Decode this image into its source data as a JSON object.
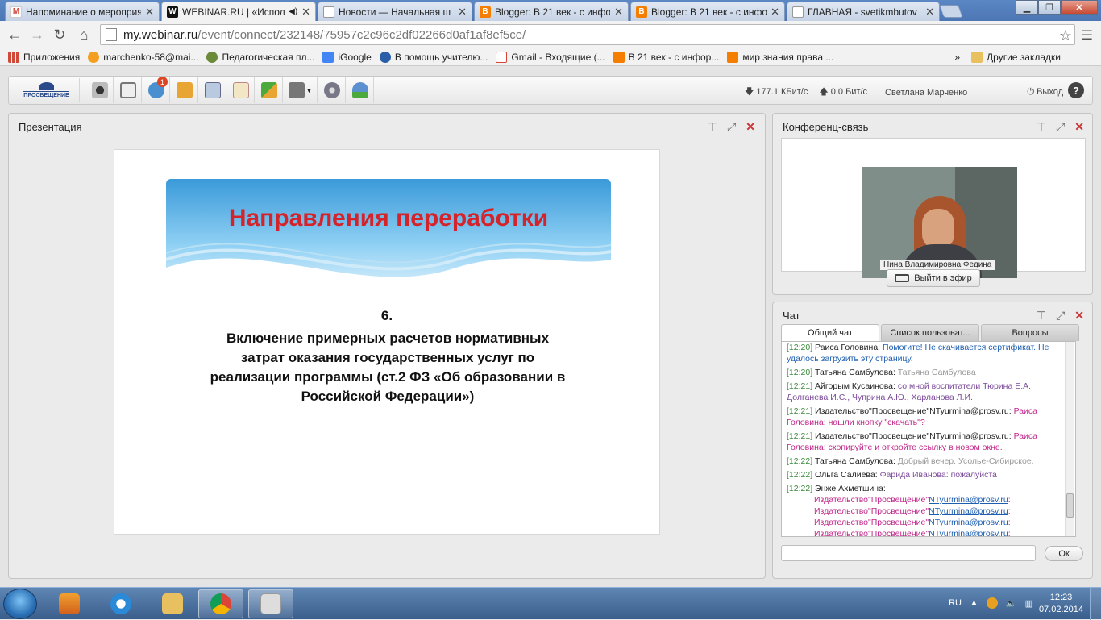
{
  "browser": {
    "tabs": [
      {
        "title": "Напоминание о мероприя",
        "favicon_color": "#d44638",
        "favicon": "M"
      },
      {
        "title": "WEBINAR.RU | «Испол",
        "favicon_color": "#111111",
        "favicon": "W",
        "audio": "◀)"
      },
      {
        "title": "Новости — Начальная ш",
        "favicon_color": "#ffffff",
        "favicon": ""
      },
      {
        "title": "Blogger: В 21 век - с инфо",
        "favicon_color": "#f57d00",
        "favicon": "B"
      },
      {
        "title": "Blogger: В 21 век - с инфо",
        "favicon_color": "#f57d00",
        "favicon": "B"
      },
      {
        "title": "ГЛАВНАЯ - svetikmbutov",
        "favicon_color": "#ffffff",
        "favicon": ""
      }
    ],
    "address": {
      "host": "my.webinar.ru",
      "path": "/event/connect/232148/75957c2c96c2df02266d0af1af8ef5ce/"
    },
    "bookmarks": [
      {
        "label": "Приложения",
        "color": "#d04a3a"
      },
      {
        "label": "marchenko-58@mai...",
        "color": "#f3a020"
      },
      {
        "label": "Педагогическая пл...",
        "color": "#6b8a3a"
      },
      {
        "label": "iGoogle",
        "color": "#4285f4"
      },
      {
        "label": "В помощь учителю...",
        "color": "#2a5fa8"
      },
      {
        "label": "Gmail - Входящие (...",
        "color": "#d44638"
      },
      {
        "label": "В 21 век - с инфор...",
        "color": "#f57d00"
      },
      {
        "label": "мир знания права ...",
        "color": "#f57d00"
      }
    ],
    "bookmarks_more": "»",
    "other_bookmarks": "Другие закладки"
  },
  "webinar": {
    "logo_text": "ПРОСВЕЩЕНИЕ",
    "toolbar_badge": "1",
    "status": {
      "down": "177.1 КБит/с",
      "up": "0.0 Бит/с",
      "user": "Светлана Марченко",
      "exit": "Выход",
      "help": "?"
    },
    "presentation": {
      "title": "Презентация",
      "slide_heading": "Направления переработки",
      "slide_number": "6.",
      "slide_text": "Включение примерных расчетов нормативных затрат оказания государственных услуг по реализации программы (ст.2 ФЗ «Об образовании в Российской Федерации»)"
    },
    "conference": {
      "title": "Конференц-связь",
      "speaker": "Нина Владимировна Федина",
      "go_live": "Выйти в эфир"
    },
    "chat": {
      "title": "Чат",
      "tabs": [
        "Общий чат",
        "Список пользоват...",
        "Вопросы"
      ],
      "messages": [
        {
          "time": "[12:20]",
          "author": "Раиса Головина:",
          "text": "Помогите! Не скачивается сертификат. Не удалось загрузить эту страницу.",
          "cls": "b1"
        },
        {
          "time": "[12:20]",
          "author": "Татьяна Самбулова:",
          "text": "Татьяна Самбулова",
          "cls": "b4"
        },
        {
          "time": "[12:21]",
          "author": "Айгорым  Кусаинова:",
          "text": "со мной воспитатели Тюрина Е.А., Долганева И.С., Чуприна А.Ю., Харланова Л.И.",
          "cls": "b2"
        },
        {
          "time": "[12:21]",
          "author": "Издательство\"Просвещение\"NTyurmina@prosv.ru:",
          "text": "Раиса Головина: нашли кнопку \"скачать\"?",
          "cls": "b3"
        },
        {
          "time": "[12:21]",
          "author": "Издательство\"Просвещение\"NTyurmina@prosv.ru:",
          "text": "Раиса Головина: скопируйте и откройте ссылку в новом окне.",
          "cls": "b3"
        },
        {
          "time": "[12:22]",
          "author": "Татьяна Самбулова:",
          "text": "Добрый вечер. Усолье-Сибирское.",
          "cls": "b4"
        },
        {
          "time": "[12:22]",
          "author": "Ольга Салиева:",
          "text": "Фарида Иванова: пожалуйста",
          "cls": "b2"
        },
        {
          "time": "[12:22]",
          "author": "Энже Ахметшина:",
          "text": "",
          "cls": "b3"
        }
      ],
      "repeat_prefix": "Издательство\"Просвещение\"",
      "repeat_link": "NTyurmina@prosv.ru",
      "repeat_suffix": ":",
      "ok_button": "Ок"
    }
  },
  "taskbar": {
    "lang": "RU",
    "time": "12:23",
    "date": "07.02.2014"
  }
}
